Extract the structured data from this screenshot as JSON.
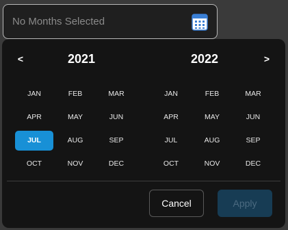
{
  "input": {
    "placeholder": "No Months Selected",
    "icon": "calendar-icon"
  },
  "nav": {
    "prev": "<",
    "next": ">"
  },
  "years": {
    "left": {
      "label": "2021",
      "months": [
        "JAN",
        "FEB",
        "MAR",
        "APR",
        "MAY",
        "JUN",
        "JUL",
        "AUG",
        "SEP",
        "OCT",
        "NOV",
        "DEC"
      ],
      "selected": "JUL"
    },
    "right": {
      "label": "2022",
      "months": [
        "JAN",
        "FEB",
        "MAR",
        "APR",
        "MAY",
        "JUN",
        "JUL",
        "AUG",
        "SEP",
        "OCT",
        "NOV",
        "DEC"
      ],
      "selected": null
    }
  },
  "buttons": {
    "cancel": "Cancel",
    "apply": "Apply"
  },
  "colors": {
    "accent": "#1890d6",
    "apply_disabled_bg": "#173c54"
  }
}
